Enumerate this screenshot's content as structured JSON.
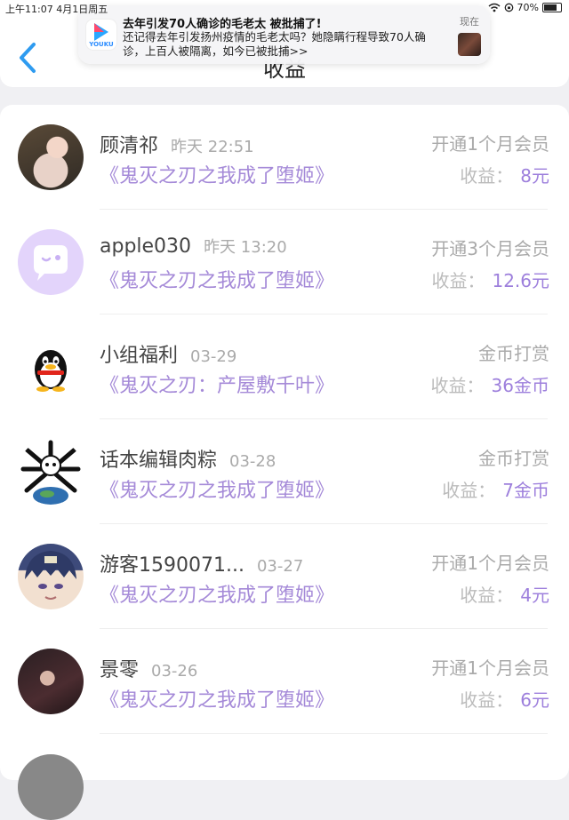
{
  "status": {
    "time": "上午11:07  4月1日周五",
    "battery": "70%"
  },
  "header": {
    "title": "收益",
    "back_icon": "chevron-left-icon",
    "accent": "#2e9bf0"
  },
  "notification": {
    "app": "YOUKU",
    "title": "去年引发70人确诊的毛老太 被批捕了!",
    "body": "还记得去年引发扬州疫情的毛老太吗？她隐瞒行程导致70人确诊，上百人被隔离，如今已被批捕>>",
    "time": "现在"
  },
  "rows": [
    {
      "name": "顾清祁",
      "date": "昨天 22:51",
      "novel": "《鬼灭之刃之我成了堕姬》",
      "type": "开通1个月会员",
      "earn_label": "收益：",
      "amount": "8元"
    },
    {
      "name": "apple030",
      "date": "昨天 13:20",
      "novel": "《鬼灭之刃之我成了堕姬》",
      "type": "开通3个月会员",
      "earn_label": "收益：",
      "amount": "12.6元"
    },
    {
      "name": "小组福利",
      "date": "03-29",
      "novel": "《鬼灭之刃：产屋敷千叶》",
      "type": "金币打赏",
      "earn_label": "收益：",
      "amount": "36金币"
    },
    {
      "name": "话本编辑肉粽",
      "date": "03-28",
      "novel": "《鬼灭之刃之我成了堕姬》",
      "type": "金币打赏",
      "earn_label": "收益：",
      "amount": "7金币"
    },
    {
      "name": "游客1590071...",
      "date": "03-27",
      "novel": "《鬼灭之刃之我成了堕姬》",
      "type": "开通1个月会员",
      "earn_label": "收益：",
      "amount": "4元"
    },
    {
      "name": "景零",
      "date": "03-26",
      "novel": "《鬼灭之刃之我成了堕姬》",
      "type": "开通1个月会员",
      "earn_label": "收益：",
      "amount": "6元"
    }
  ],
  "colors": {
    "novel": "#a58ad8",
    "amount": "#9d7fdc"
  }
}
